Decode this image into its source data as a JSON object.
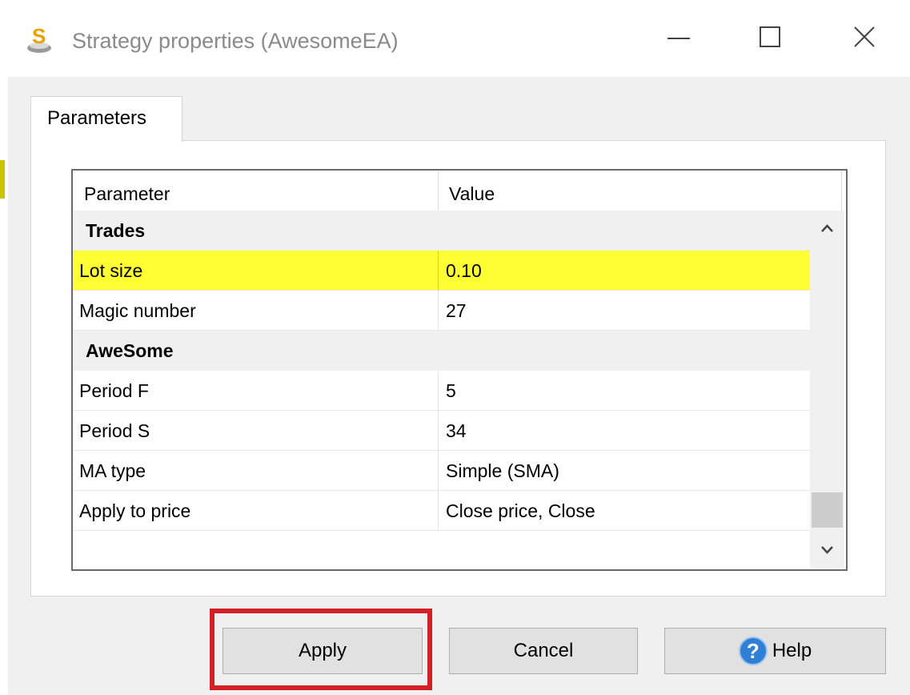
{
  "window": {
    "title": "Strategy properties (AwesomeEA)",
    "controls": [
      "minimize-icon",
      "maximize-icon",
      "close-icon"
    ]
  },
  "tabs": [
    {
      "label": "Parameters",
      "active": true
    }
  ],
  "grid": {
    "columns": [
      "Parameter",
      "Value"
    ],
    "rows": [
      {
        "type": "group",
        "name": "Trades",
        "value": ""
      },
      {
        "type": "param",
        "name": "Lot size",
        "value": "0.10",
        "selected": true
      },
      {
        "type": "param",
        "name": "Magic number",
        "value": "27"
      },
      {
        "type": "group",
        "name": "AweSome",
        "value": ""
      },
      {
        "type": "param",
        "name": "Period F",
        "value": "5"
      },
      {
        "type": "param",
        "name": "Period S",
        "value": "34"
      },
      {
        "type": "param",
        "name": "MA type",
        "value": "Simple (SMA)"
      },
      {
        "type": "param",
        "name": "Apply to price",
        "value": "Close price, Close"
      }
    ]
  },
  "buttons": {
    "apply": "Apply",
    "cancel": "Cancel",
    "help": "Help"
  },
  "colors": {
    "selected_row": "#ffff33",
    "highlight_box": "#d32027",
    "help_icon": "#2f7fd6"
  }
}
